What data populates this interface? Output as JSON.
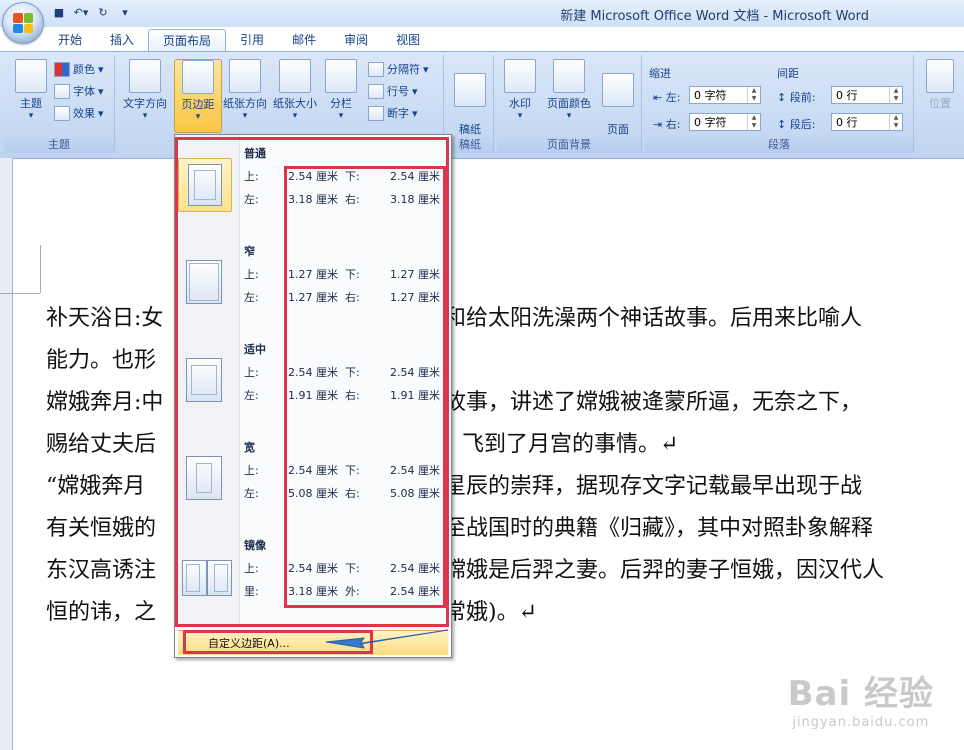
{
  "window": {
    "title": "新建 Microsoft Office Word 文档 - Microsoft Word"
  },
  "tabs": [
    "开始",
    "插入",
    "页面布局",
    "引用",
    "邮件",
    "审阅",
    "视图"
  ],
  "active_tab": "页面布局",
  "ribbon": {
    "theme_group": {
      "label": "主题",
      "theme_button": "主题",
      "colors": "颜色",
      "fonts": "字体",
      "effects": "效果"
    },
    "page_setup": {
      "text_direction": "文字方向",
      "margins": "页边距",
      "orientation": "纸张方向",
      "size": "纸张大小",
      "columns": "分栏",
      "breaks": "分隔符",
      "line_numbers": "行号",
      "hyphenation": "断字"
    },
    "paper_group": {
      "label": "稿纸",
      "button": "稿纸\n设置"
    },
    "background_group": {
      "label": "页面背景",
      "watermark": "水印",
      "page_color": "页面颜色",
      "page_borders": "页面\n边框"
    },
    "paragraph_group": {
      "label": "段落",
      "indent_title": "缩进",
      "spacing_title": "间距",
      "left_label": "左:",
      "left_value": "0 字符",
      "right_label": "右:",
      "right_value": "0 字符",
      "before_label": "段前:",
      "before_value": "0 行",
      "after_label": "段后:",
      "after_value": "0 行"
    },
    "position_button": "位置"
  },
  "document": {
    "lines": [
      "补天浴日:女",
      "和给太阳洗澡两个神话故事。后用来比喻人",
      "能力。也形",
      "嫦娥奔月:中",
      "故事，讲述了嫦娥被逄蒙所逼，无奈之下，",
      "赐给丈夫后",
      "飞到了月宫的事情。↵",
      "“嫦娥奔月",
      "星辰的崇拜，据现存文字记载最早出现于战",
      "有关恒娥的",
      "至战国时的典籍《归藏》，其中对照卦象解释",
      "东汉高诱注",
      "嫦娥是后羿之妻。后羿的妻子恒娥，因汉代人",
      "恒的讳，之",
      "常娥)。↵"
    ]
  },
  "margins_menu": {
    "items": [
      {
        "name": "普通",
        "top_label": "上:",
        "top": "2.54 厘米",
        "bottom_label": "下:",
        "bottom": "2.54 厘米",
        "left_label": "左:",
        "left": "3.18 厘米",
        "right_label": "右:",
        "right": "3.18 厘米"
      },
      {
        "name": "窄",
        "top_label": "上:",
        "top": "1.27 厘米",
        "bottom_label": "下:",
        "bottom": "1.27 厘米",
        "left_label": "左:",
        "left": "1.27 厘米",
        "right_label": "右:",
        "right": "1.27 厘米"
      },
      {
        "name": "适中",
        "top_label": "上:",
        "top": "2.54 厘米",
        "bottom_label": "下:",
        "bottom": "2.54 厘米",
        "left_label": "左:",
        "left": "1.91 厘米",
        "right_label": "右:",
        "right": "1.91 厘米"
      },
      {
        "name": "宽",
        "top_label": "上:",
        "top": "2.54 厘米",
        "bottom_label": "下:",
        "bottom": "2.54 厘米",
        "left_label": "左:",
        "left": "5.08 厘米",
        "right_label": "右:",
        "right": "5.08 厘米"
      },
      {
        "name": "镜像",
        "top_label": "上:",
        "top": "2.54 厘米",
        "bottom_label": "下:",
        "bottom": "2.54 厘米",
        "left_label": "里:",
        "left": "3.18 厘米",
        "right_label": "外:",
        "right": "2.54 厘米"
      }
    ],
    "custom_label": "自定义边距(A)..."
  },
  "watermark": {
    "main": "Bai 经验",
    "sub": "jingyan.baidu.com"
  },
  "colors": {
    "highlight": "#e0344a",
    "arrow": "#3a78c9"
  }
}
